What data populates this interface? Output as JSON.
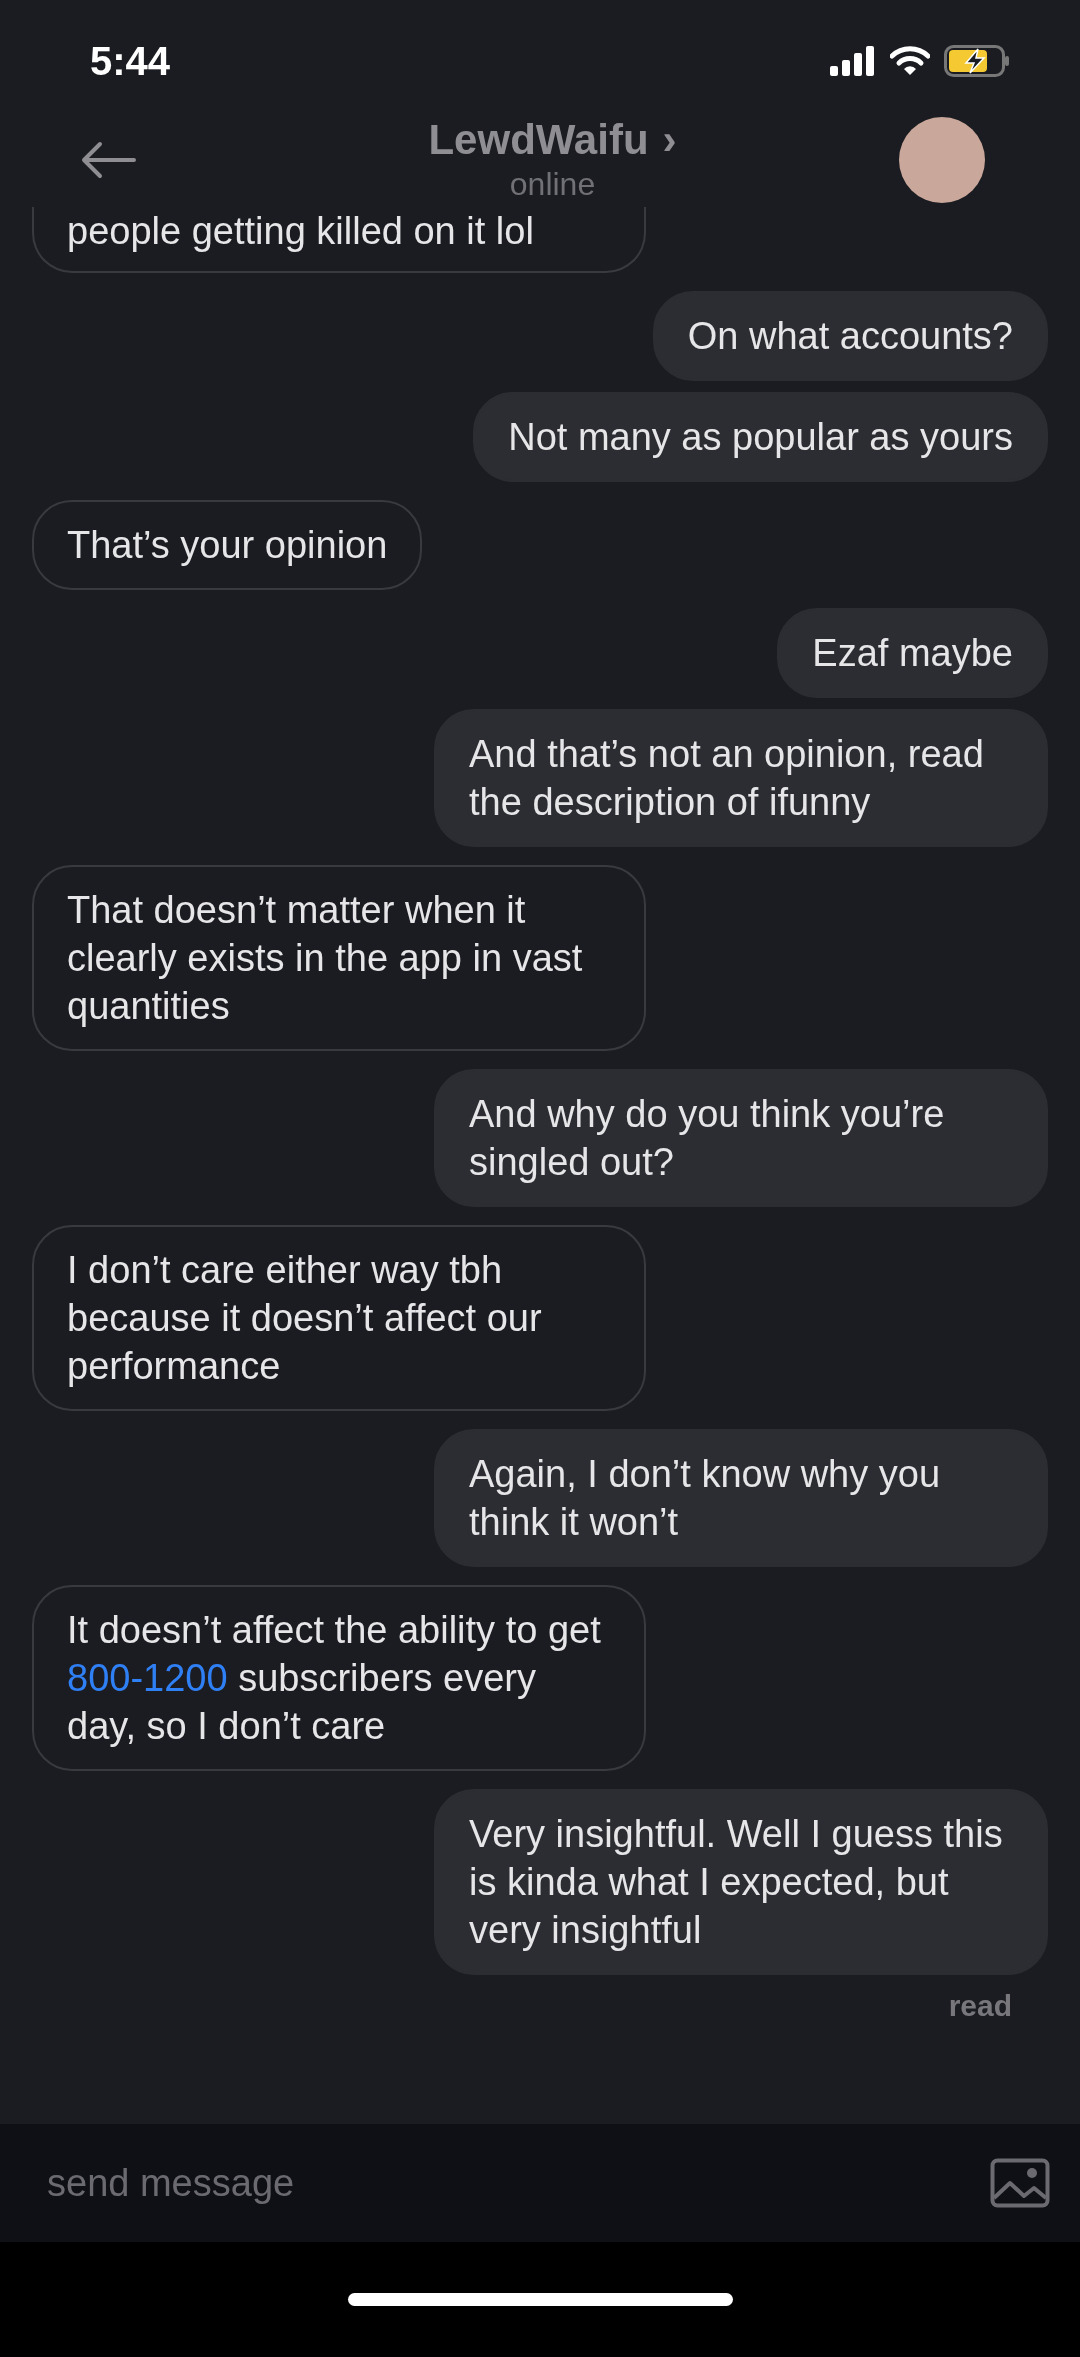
{
  "status_bar": {
    "time": "5:44"
  },
  "header": {
    "title": "LewdWaifu",
    "chevron": "›",
    "subtitle": "online"
  },
  "messages": [
    {
      "kind": "received",
      "clipped": true,
      "parts": [
        {
          "text": "people getting killed on it lol"
        }
      ]
    },
    {
      "kind": "sent",
      "parts": [
        {
          "text": "On what accounts?"
        }
      ]
    },
    {
      "kind": "sent",
      "parts": [
        {
          "text": "Not many as popular as yours"
        }
      ]
    },
    {
      "kind": "received",
      "parts": [
        {
          "text": "That’s your opinion"
        }
      ]
    },
    {
      "kind": "sent",
      "parts": [
        {
          "text": "Ezaf maybe"
        }
      ]
    },
    {
      "kind": "sent",
      "parts": [
        {
          "text": "And that’s not an opinion, read the description of ifunny"
        }
      ]
    },
    {
      "kind": "received",
      "parts": [
        {
          "text": "That doesn’t matter when it clearly exists in the app in vast quantities"
        }
      ]
    },
    {
      "kind": "sent",
      "parts": [
        {
          "text": "And why do you think you’re singled out?"
        }
      ]
    },
    {
      "kind": "received",
      "parts": [
        {
          "text": "I don’t care either way tbh because it doesn’t affect our performance"
        }
      ]
    },
    {
      "kind": "sent",
      "parts": [
        {
          "text": "Again, I don’t know why you think it won’t"
        }
      ]
    },
    {
      "kind": "received",
      "parts": [
        {
          "text": "It doesn’t affect the ability to get "
        },
        {
          "text": "800-1200",
          "kind": "link"
        },
        {
          "text": " subscribers every day, so I don’t care"
        }
      ]
    },
    {
      "kind": "sent",
      "parts": [
        {
          "text": "Very insightful. Well I guess this is kinda what I expected, but very insightful"
        }
      ]
    }
  ],
  "read_receipt": "read",
  "composer": {
    "placeholder": "send message"
  }
}
